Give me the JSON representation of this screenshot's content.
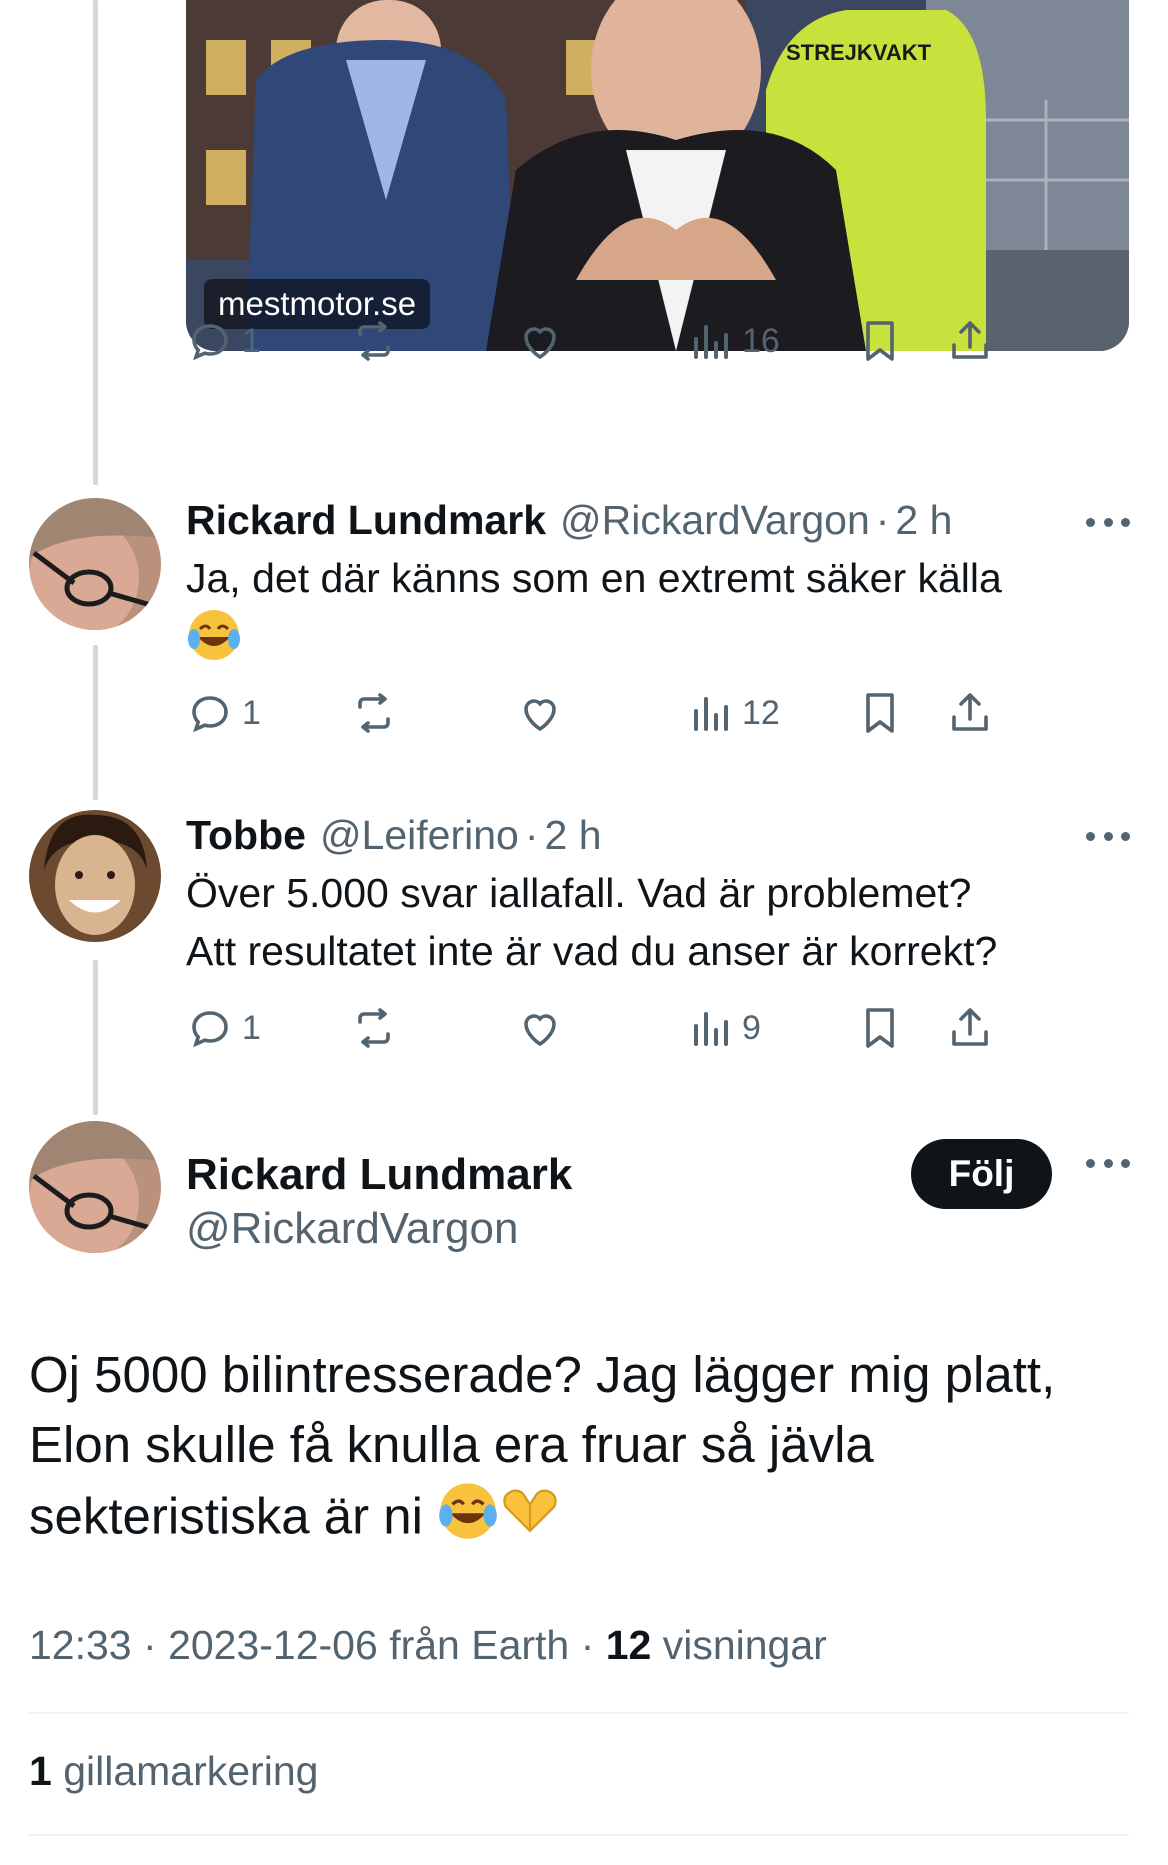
{
  "link_card": {
    "domain": "mestmotor.se",
    "image_sign_text": "STREJKVAKT",
    "actions": {
      "replies": "1",
      "retweets": "",
      "likes": "",
      "views": "16"
    }
  },
  "replies": [
    {
      "name": "Rickard Lundmark",
      "handle": "@RickardVargon",
      "separator": "·",
      "time": "2 h",
      "text": "Ja, det där känns som en extremt säker källa",
      "emoji": [
        "face-with-tears-of-joy"
      ],
      "actions": {
        "replies": "1",
        "views": "12"
      }
    },
    {
      "name": "Tobbe",
      "handle": "@Leiferino",
      "separator": "·",
      "time": "2 h",
      "text_line1": "Över 5.000 svar iallafall. Vad är problemet?",
      "text_line2": "Att resultatet inte är vad du anser är korrekt?",
      "actions": {
        "replies": "1",
        "views": "9"
      }
    }
  ],
  "main_tweet": {
    "name": "Rickard Lundmark",
    "handle": "@RickardVargon",
    "follow_label": "Följ",
    "text_line1": "Oj 5000 bilintresserade? Jag lägger mig platt,",
    "text_line2": "Elon skulle få knulla era fruar så jävla",
    "text_line3": "sekteristiska är ni",
    "emoji": [
      "face-with-tears-of-joy",
      "heart-hands"
    ],
    "time": "12:33",
    "date": "2023-12-06",
    "source": "från Earth",
    "views_count": "12",
    "views_label": "visningar",
    "likes_count": "1",
    "likes_label": "gillamarkering"
  },
  "colors": {
    "text": "#0f1419",
    "secondary": "#536471",
    "thread_line": "#cfd9de",
    "divider": "#eff3f4",
    "follow_bg": "#0f1419"
  }
}
